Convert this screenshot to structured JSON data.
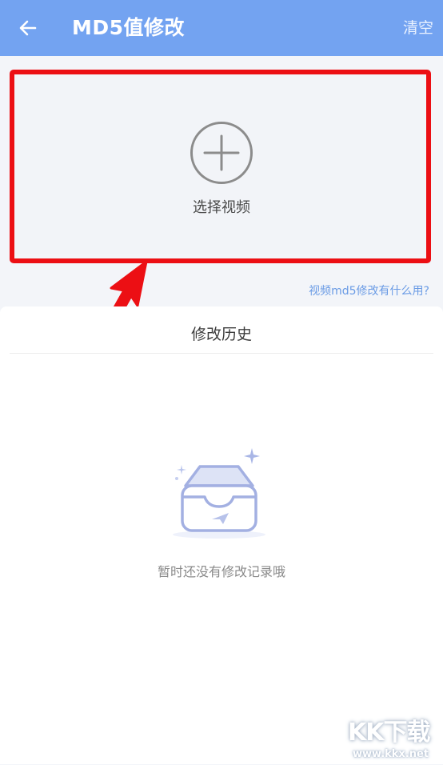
{
  "header": {
    "title": "MD5值修改",
    "clear_label": "清空",
    "back_icon": "arrow-left-icon",
    "background": "#73a3f1"
  },
  "select_card": {
    "label": "选择视频",
    "icon": "add-circle-icon",
    "highlight_color": "#ec0f14"
  },
  "help_link": {
    "label": "视频md5修改有什么用?",
    "color": "#6a9be5"
  },
  "history": {
    "title": "修改历史",
    "empty_icon": "empty-inbox-icon",
    "empty_message": "暂时还没有修改记录哦"
  },
  "watermark": {
    "logo": "KK下载",
    "url": "www.kkx.net"
  }
}
